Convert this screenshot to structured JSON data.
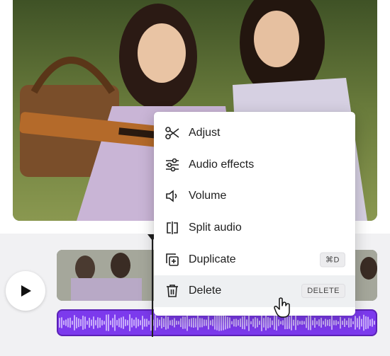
{
  "context_menu": {
    "items": [
      {
        "label": "Adjust",
        "icon": "scissors-icon"
      },
      {
        "label": "Audio effects",
        "icon": "sliders-icon"
      },
      {
        "label": "Volume",
        "icon": "volume-icon"
      },
      {
        "label": "Split audio",
        "icon": "split-icon"
      },
      {
        "label": "Duplicate",
        "icon": "duplicate-icon",
        "shortcut": "⌘D"
      },
      {
        "label": "Delete",
        "icon": "trash-icon",
        "shortcut": "DELETE"
      }
    ]
  },
  "colors": {
    "audio_track": "#7c3aed",
    "menu_hover": "#eef0f2"
  },
  "player": {
    "play_icon": "play-icon"
  }
}
